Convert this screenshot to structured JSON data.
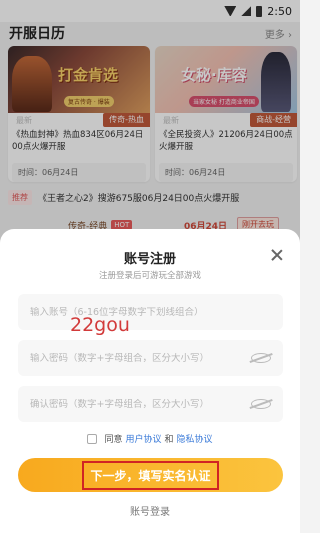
{
  "status_bar": {
    "time": "2:50"
  },
  "header": {
    "title": "开服日历",
    "more": "更多 ›"
  },
  "cards": [
    {
      "banner_title": "打金肯选",
      "banner_sub": "复古传奇 · 爆装",
      "tag_new": "最新",
      "category": "传奇-热血",
      "desc": "《热血封神》热血834区06月24日00点火爆开服",
      "time": "时间：06月24日"
    },
    {
      "banner_title": "女秘·库容",
      "banner_sub": "当家女秘 打造商业帝国",
      "tag_new": "最新",
      "category": "商战-经营",
      "desc": "《全民投资人》21206月24日00点火爆开服",
      "time": "时间：06月24日"
    }
  ],
  "recommend": {
    "badge": "推荐",
    "text": "《王者之心2》搜游675服06月24日00点火爆开服",
    "genre": "传奇-经典",
    "hot": "HOT",
    "date": "06月24日",
    "button": "刚开去玩"
  },
  "modal": {
    "title": "账号注册",
    "subtitle": "注册登录后可游玩全部游戏",
    "account_placeholder": "输入账号（6-16位字母数字下划线组合）",
    "password_placeholder": "输入密码（数字+字母组合，区分大小写）",
    "confirm_placeholder": "确认密码（数字+字母组合，区分大小写）",
    "watermark": "22gou",
    "agree_prefix": "同意",
    "user_agreement": "用户协议",
    "and": "和",
    "privacy_agreement": "隐私协议",
    "next_button": "下一步，填写实名认证",
    "login_link": "账号登录"
  }
}
